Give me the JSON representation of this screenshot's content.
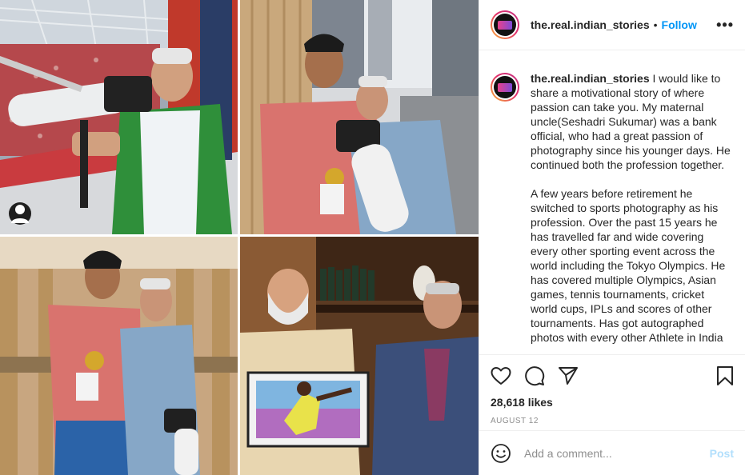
{
  "post": {
    "username": "the.real.indian_stories",
    "separator": "•",
    "follow_label": "Follow",
    "more_label": "•••",
    "caption_paragraphs": [
      "I would like to share a motivational story of where passion can take you. My maternal uncle(Seshadri Sukumar) was a bank official, who had a great passion of photography since his younger days. He continued both the profession together.",
      "A few years before retirement he switched to sports photography as his profession. Over the past 15 years he has travelled far and wide covering every other sporting event across the world including the Tokyo Olympics. He has covered multiple Olympics, Asian games, tennis tournaments, cricket world cups, IPLs and scores of other tournaments. Has got autographed photos with every other Athlete in India"
    ],
    "likes": "28,618 likes",
    "date": "AUGUST 12",
    "comment_placeholder": "Add a comment...",
    "post_label": "Post"
  },
  "icons": {
    "like": "heart-icon",
    "comment": "comment-icon",
    "share": "share-icon",
    "save": "bookmark-icon",
    "emoji": "emoji-icon",
    "tagged": "user-tag-icon"
  },
  "colors": {
    "link": "#0095f6",
    "post_disabled": "#b2dffc",
    "muted": "#8e8e8e",
    "text": "#262626"
  }
}
